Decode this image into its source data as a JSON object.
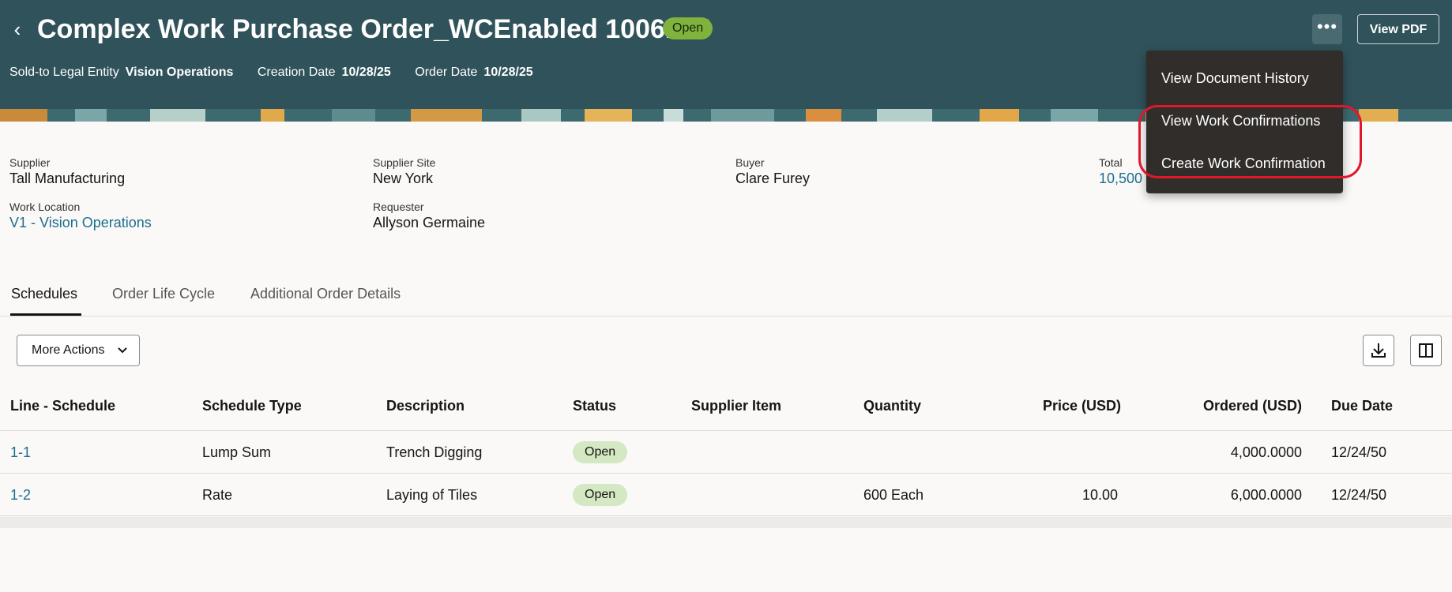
{
  "header": {
    "title": "Complex Work Purchase Order_WCEnabled 1006127",
    "status_badge": "Open",
    "meta": [
      {
        "label": "Sold-to Legal Entity",
        "value": "Vision Operations"
      },
      {
        "label": "Creation Date",
        "value": "10/28/25"
      },
      {
        "label": "Order Date",
        "value": "10/28/25"
      }
    ],
    "overflow_button": "•••",
    "view_pdf_label": "View PDF"
  },
  "menu": {
    "items": [
      {
        "label": "View Document History"
      },
      {
        "label": "View Work Confirmations"
      },
      {
        "label": "Create Work Confirmation"
      }
    ]
  },
  "info": {
    "supplier": {
      "label": "Supplier",
      "value": "Tall Manufacturing"
    },
    "supplier_site": {
      "label": "Supplier Site",
      "value": "New York"
    },
    "buyer": {
      "label": "Buyer",
      "value": "Clare Furey"
    },
    "total": {
      "label": "Total",
      "value": "10,500"
    },
    "work_location": {
      "label": "Work Location",
      "value": "V1 - Vision Operations"
    },
    "requester": {
      "label": "Requester",
      "value": "Allyson Germaine"
    }
  },
  "tabs": [
    {
      "label": "Schedules"
    },
    {
      "label": "Order Life Cycle"
    },
    {
      "label": "Additional Order Details"
    }
  ],
  "toolbar": {
    "more_actions_label": "More Actions"
  },
  "table": {
    "columns": [
      "Line - Schedule",
      "Schedule Type",
      "Description",
      "Status",
      "Supplier Item",
      "Quantity",
      "Price (USD)",
      "Ordered (USD)",
      "Due Date"
    ],
    "rows": [
      {
        "line": "1-1",
        "type": "Lump Sum",
        "description": "Trench Digging",
        "status": "Open",
        "supplier_item": "",
        "quantity": "",
        "price": "",
        "ordered": "4,000.0000",
        "due": "12/24/50"
      },
      {
        "line": "1-2",
        "type": "Rate",
        "description": "Laying of Tiles",
        "status": "Open",
        "supplier_item": "",
        "quantity": "600 Each",
        "price": "10.00",
        "ordered": "6,000.0000",
        "due": "12/24/50"
      }
    ]
  },
  "colors": {
    "header_bg": "#30525a",
    "link": "#1d6e8f",
    "status_badge": "#7fb33d",
    "menu_bg": "#312d2a",
    "highlight": "#e0182b"
  }
}
